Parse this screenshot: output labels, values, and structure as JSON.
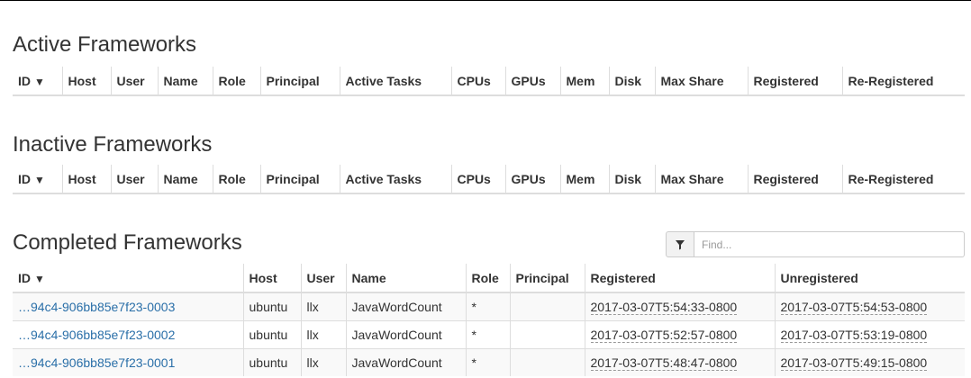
{
  "active": {
    "title": "Active Frameworks",
    "columns": [
      "ID",
      "Host",
      "User",
      "Name",
      "Role",
      "Principal",
      "Active Tasks",
      "CPUs",
      "GPUs",
      "Mem",
      "Disk",
      "Max Share",
      "Registered",
      "Re-Registered"
    ]
  },
  "inactive": {
    "title": "Inactive Frameworks",
    "columns": [
      "ID",
      "Host",
      "User",
      "Name",
      "Role",
      "Principal",
      "Active Tasks",
      "CPUs",
      "GPUs",
      "Mem",
      "Disk",
      "Max Share",
      "Registered",
      "Re-Registered"
    ]
  },
  "completed": {
    "title": "Completed Frameworks",
    "filter_placeholder": "Find...",
    "columns": [
      "ID",
      "Host",
      "User",
      "Name",
      "Role",
      "Principal",
      "Registered",
      "Unregistered"
    ],
    "rows": [
      {
        "id": "…94c4-906bb85e7f23-0003",
        "host": "ubuntu",
        "user": "llx",
        "name": "JavaWordCount",
        "role": "*",
        "principal": "",
        "registered": "2017-03-07T5:54:33-0800",
        "unregistered": "2017-03-07T5:54:53-0800"
      },
      {
        "id": "…94c4-906bb85e7f23-0002",
        "host": "ubuntu",
        "user": "llx",
        "name": "JavaWordCount",
        "role": "*",
        "principal": "",
        "registered": "2017-03-07T5:52:57-0800",
        "unregistered": "2017-03-07T5:53:19-0800"
      },
      {
        "id": "…94c4-906bb85e7f23-0001",
        "host": "ubuntu",
        "user": "llx",
        "name": "JavaWordCount",
        "role": "*",
        "principal": "",
        "registered": "2017-03-07T5:48:47-0800",
        "unregistered": "2017-03-07T5:49:15-0800"
      }
    ]
  },
  "sort_indicator": "▼",
  "icons": {
    "filter": "filter-icon",
    "sort": "sort-down-icon"
  },
  "colors": {
    "link": "#2a6fa8",
    "border": "#dddddd",
    "stripe": "#f9f9f9"
  }
}
